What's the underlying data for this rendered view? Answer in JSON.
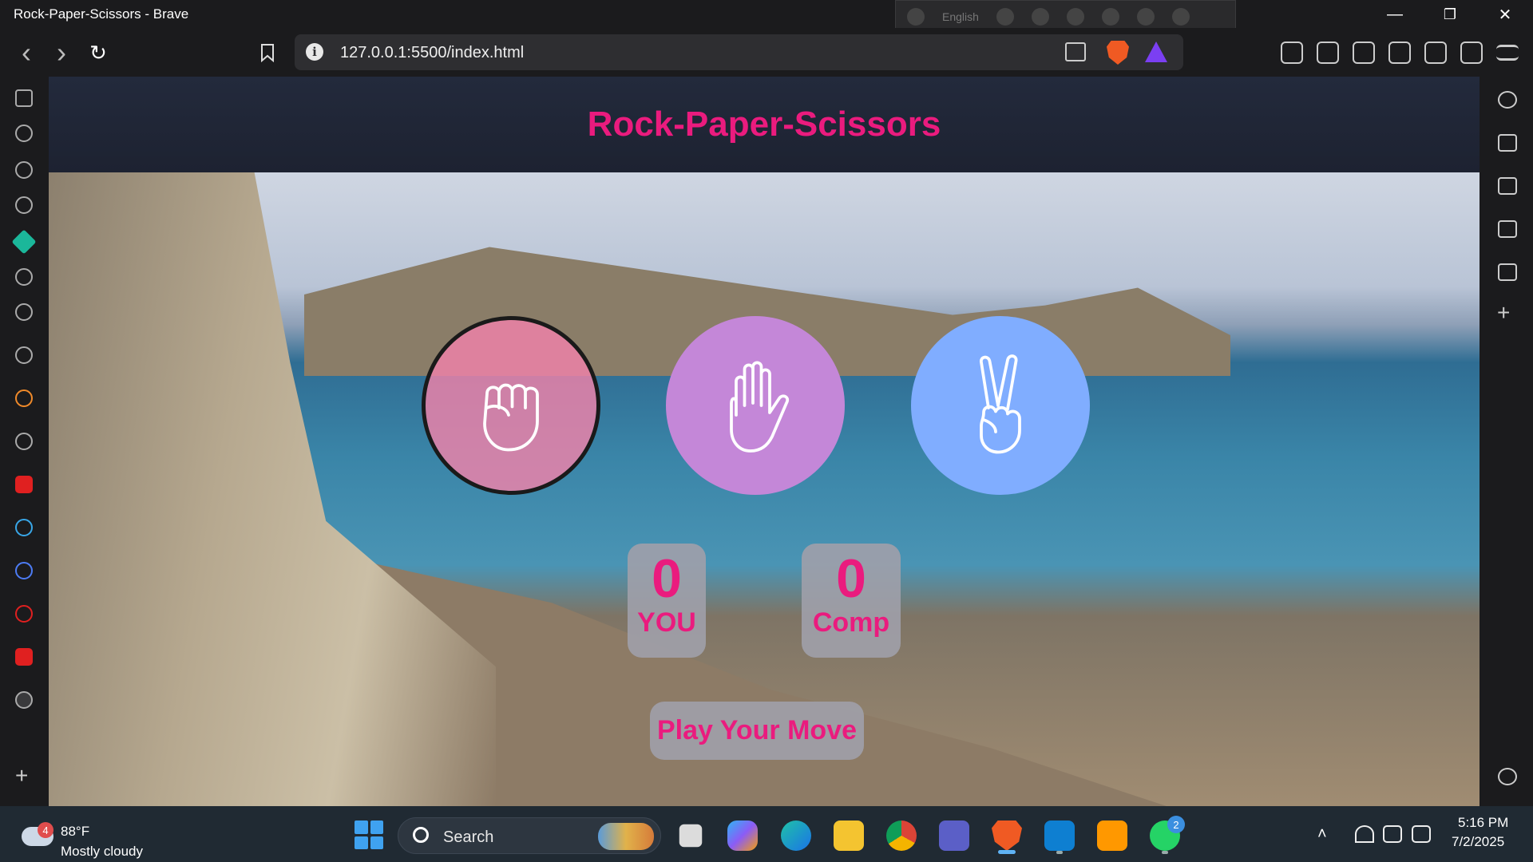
{
  "window": {
    "title": "Rock-Paper-Scissors - Brave",
    "ime_language": "English",
    "minimize": "—",
    "restore": "❐",
    "close": "✕"
  },
  "toolbar": {
    "back": "‹",
    "forward": "›",
    "reload": "↻",
    "url": "127.0.0.1:5500/index.html",
    "info": "i"
  },
  "page": {
    "title": "Rock-Paper-Scissors",
    "choices": [
      {
        "id": "rock",
        "icon": "fist-icon"
      },
      {
        "id": "paper",
        "icon": "open-hand-icon"
      },
      {
        "id": "scissors",
        "icon": "peace-hand-icon"
      }
    ],
    "score": {
      "user": "0",
      "user_label": "YOU",
      "comp": "0",
      "comp_label": "Comp"
    },
    "message": "Play Your Move"
  },
  "colors": {
    "accent": "#ea1b7e",
    "rock": "#f082aa",
    "paper": "#c487d8",
    "scissors": "#80adff"
  },
  "sidebar_add": "+",
  "taskbar": {
    "weather": {
      "temp": "88°F",
      "desc": "Mostly cloudy",
      "badge": "4"
    },
    "search_placeholder": "Search",
    "whatsapp_badge": "2",
    "clock": {
      "time": "5:16 PM",
      "date": "7/2/2025"
    },
    "tray_chevron": "˄"
  }
}
